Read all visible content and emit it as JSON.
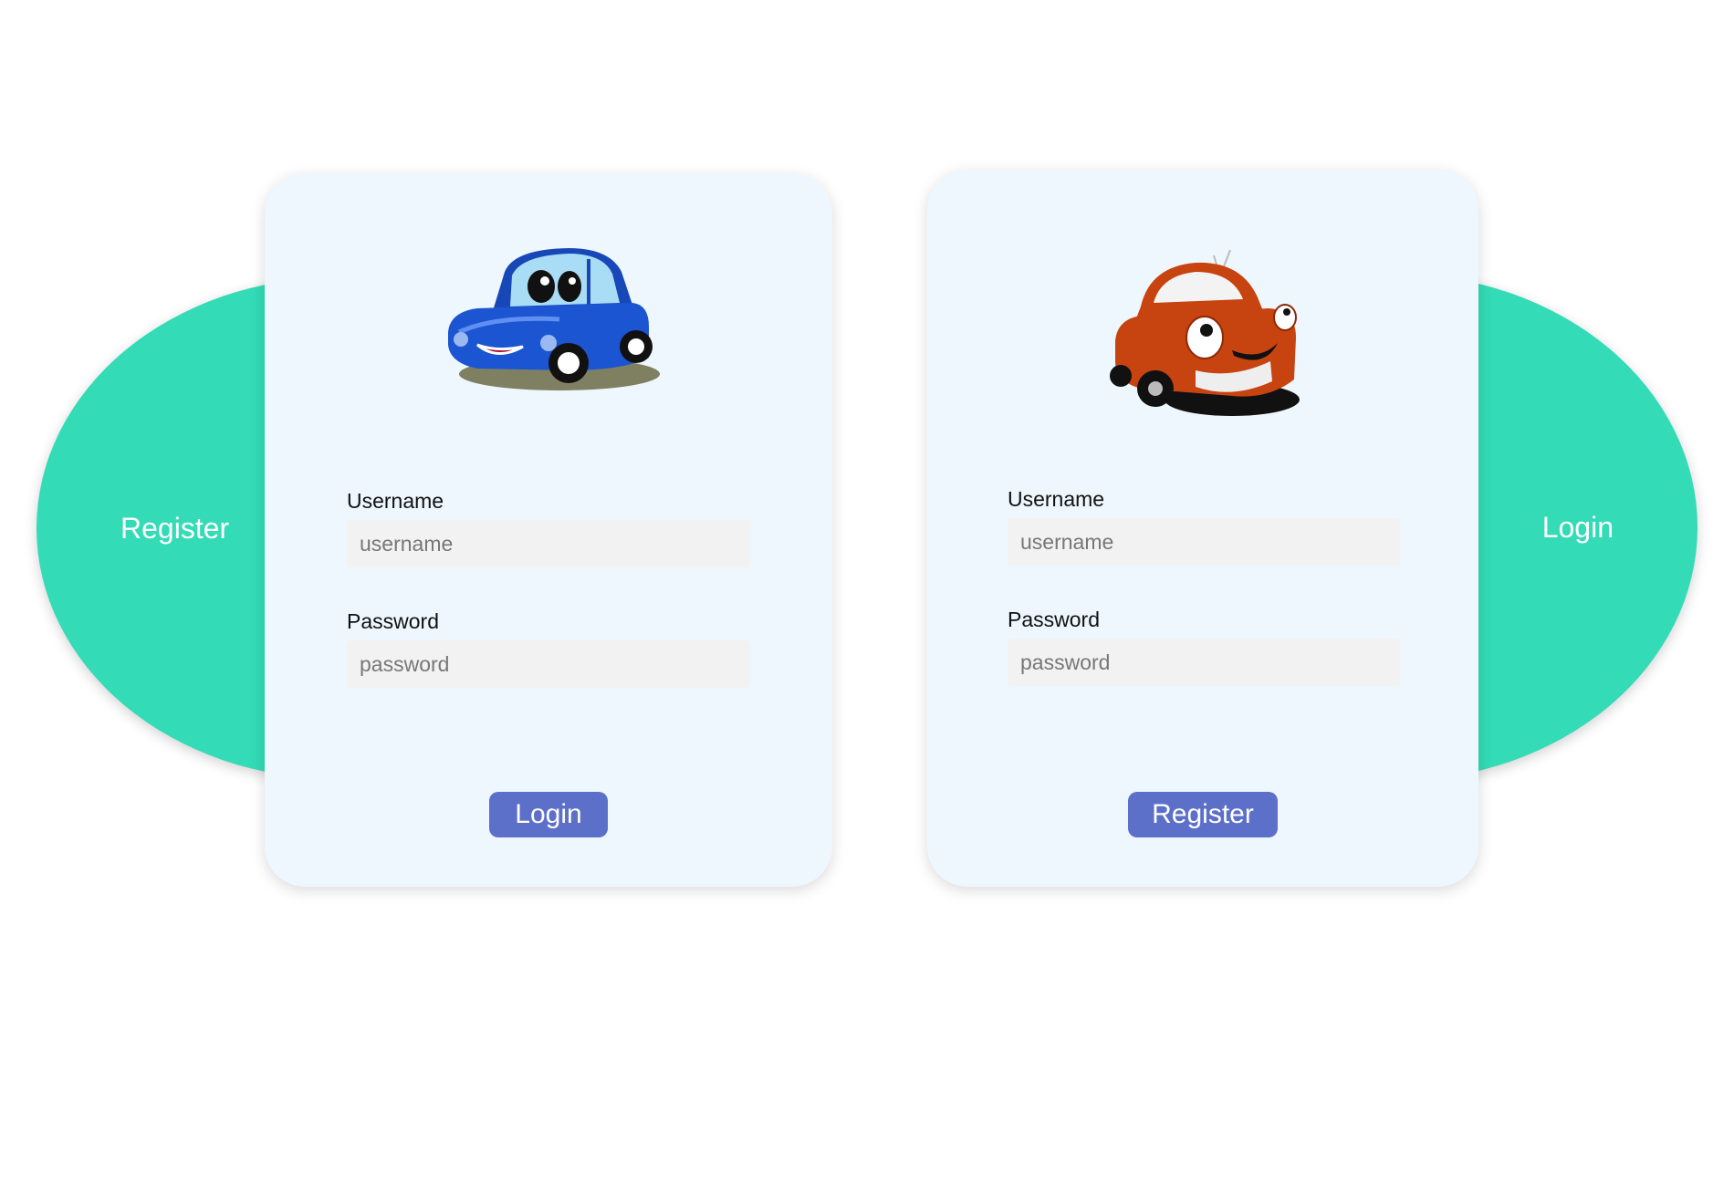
{
  "colors": {
    "accent_bubble": "#33dbb6",
    "card_bg": "#eef7fe",
    "button": "#5c6fc9"
  },
  "left_bubble": {
    "label": "Register"
  },
  "right_bubble": {
    "label": "Login"
  },
  "login_card": {
    "image": "blue-cartoon-car",
    "username_label": "Username",
    "username_placeholder": "username",
    "password_label": "Password",
    "password_placeholder": "password",
    "submit_label": "Login"
  },
  "register_card": {
    "image": "red-cartoon-car",
    "username_label": "Username",
    "username_placeholder": "username",
    "password_label": "Password",
    "password_placeholder": "password",
    "submit_label": "Register"
  }
}
